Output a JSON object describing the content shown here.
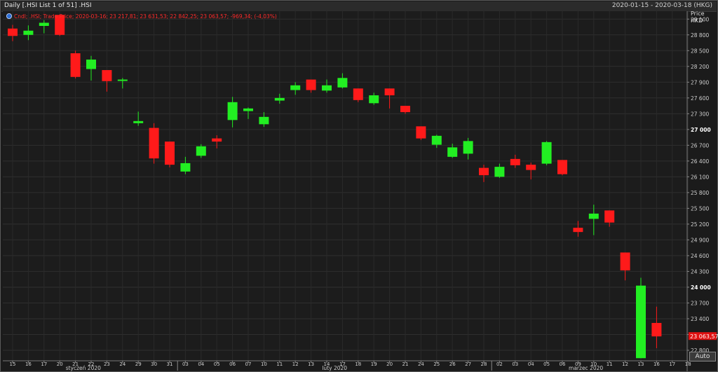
{
  "window": {
    "title": "Daily [.HSI List 1 of 51] .HSI",
    "date_range": "2020-01-15 - 2020-03-18 (HKG)"
  },
  "legend": {
    "text": "Cndl; .HSI; Trade Price; 2020-03-16; 23 217,81; 23 631,53; 22 842,25; 23 063,57; -969,34; (-4,03%)"
  },
  "axis": {
    "price_label": "Price",
    "currency_label": "HKD",
    "auto_label": "Auto",
    "last_price_label": "23 063,57"
  },
  "colors": {
    "up": "#22ee22",
    "down": "#ff1a1a",
    "background": "#1b1b1b",
    "grid": "#2e2e2e"
  },
  "chart_data": {
    "type": "candlestick",
    "ylim": [
      22600,
      29250
    ],
    "yticks": [
      22800,
      23100,
      23400,
      23700,
      24000,
      24300,
      24600,
      24900,
      25200,
      25500,
      25800,
      26100,
      26400,
      26700,
      27000,
      27300,
      27600,
      27900,
      28200,
      28500,
      28800,
      29100
    ],
    "ytick_labels": [
      "22 800",
      "23 100",
      "23 400",
      "23 700",
      "24 000",
      "24 300",
      "24 600",
      "24 900",
      "25 200",
      "25 500",
      "25 800",
      "26 100",
      "26 400",
      "26 700",
      "27 000",
      "27 300",
      "27 600",
      "27 900",
      "28 200",
      "28 500",
      "28 800",
      "29 100"
    ],
    "bold_ytick_labels": [
      "24 000",
      "27 000"
    ],
    "x_labels": [
      "15",
      "16",
      "17",
      "20",
      "21",
      "22",
      "23",
      "24",
      "29",
      "30",
      "31",
      "03",
      "04",
      "05",
      "06",
      "07",
      "10",
      "11",
      "12",
      "13",
      "14",
      "17",
      "18",
      "19",
      "20",
      "21",
      "24",
      "25",
      "26",
      "27",
      "28",
      "02",
      "03",
      "04",
      "05",
      "06",
      "09",
      "10",
      "11",
      "12",
      "13",
      "16",
      "17",
      "18"
    ],
    "month_labels": [
      {
        "label": "styczeń 2020",
        "at_index": 4.5
      },
      {
        "label": "luty 2020",
        "at_index": 20.5
      },
      {
        "label": "marzec 2020",
        "at_index": 36.5
      }
    ],
    "month_separators_before_index": [
      11,
      31
    ],
    "candles": [
      {
        "x": "2020-01-15",
        "o": 28920,
        "h": 28990,
        "l": 28680,
        "c": 28780
      },
      {
        "x": "2020-01-16",
        "o": 28800,
        "h": 28980,
        "l": 28700,
        "c": 28880
      },
      {
        "x": "2020-01-17",
        "o": 28970,
        "h": 29080,
        "l": 28830,
        "c": 29030
      },
      {
        "x": "2020-01-20",
        "o": 29180,
        "h": 29180,
        "l": 28780,
        "c": 28800
      },
      {
        "x": "2020-01-21",
        "o": 28450,
        "h": 28500,
        "l": 27970,
        "c": 28000
      },
      {
        "x": "2020-01-22",
        "o": 28150,
        "h": 28400,
        "l": 27930,
        "c": 28330
      },
      {
        "x": "2020-01-23",
        "o": 28130,
        "h": 28130,
        "l": 27720,
        "c": 27920
      },
      {
        "x": "2020-01-24",
        "o": 27930,
        "h": 27980,
        "l": 27780,
        "c": 27950
      },
      {
        "x": "2020-01-29",
        "o": 27120,
        "h": 27340,
        "l": 27070,
        "c": 27160
      },
      {
        "x": "2020-01-30",
        "o": 27030,
        "h": 27120,
        "l": 26350,
        "c": 26450
      },
      {
        "x": "2020-01-31",
        "o": 26770,
        "h": 26770,
        "l": 26280,
        "c": 26330
      },
      {
        "x": "2020-02-03",
        "o": 26200,
        "h": 26480,
        "l": 26150,
        "c": 26360
      },
      {
        "x": "2020-02-04",
        "o": 26500,
        "h": 26720,
        "l": 26460,
        "c": 26680
      },
      {
        "x": "2020-02-05",
        "o": 26830,
        "h": 26890,
        "l": 26640,
        "c": 26770
      },
      {
        "x": "2020-02-06",
        "o": 27180,
        "h": 27620,
        "l": 27040,
        "c": 27520
      },
      {
        "x": "2020-02-07",
        "o": 27350,
        "h": 27420,
        "l": 27200,
        "c": 27400
      },
      {
        "x": "2020-02-10",
        "o": 27100,
        "h": 27330,
        "l": 27050,
        "c": 27240
      },
      {
        "x": "2020-02-11",
        "o": 27550,
        "h": 27680,
        "l": 27490,
        "c": 27600
      },
      {
        "x": "2020-02-12",
        "o": 27750,
        "h": 27900,
        "l": 27660,
        "c": 27840
      },
      {
        "x": "2020-02-13",
        "o": 27950,
        "h": 27950,
        "l": 27700,
        "c": 27750
      },
      {
        "x": "2020-02-14",
        "o": 27740,
        "h": 27950,
        "l": 27700,
        "c": 27840
      },
      {
        "x": "2020-02-17",
        "o": 27800,
        "h": 28070,
        "l": 27780,
        "c": 27980
      },
      {
        "x": "2020-02-18",
        "o": 27780,
        "h": 27780,
        "l": 27520,
        "c": 27560
      },
      {
        "x": "2020-02-19",
        "o": 27500,
        "h": 27700,
        "l": 27470,
        "c": 27650
      },
      {
        "x": "2020-02-20",
        "o": 27780,
        "h": 27780,
        "l": 27400,
        "c": 27650
      },
      {
        "x": "2020-02-21",
        "o": 27450,
        "h": 27450,
        "l": 27300,
        "c": 27330
      },
      {
        "x": "2020-02-24",
        "o": 27060,
        "h": 27060,
        "l": 26800,
        "c": 26830
      },
      {
        "x": "2020-02-25",
        "o": 26710,
        "h": 26900,
        "l": 26650,
        "c": 26880
      },
      {
        "x": "2020-02-26",
        "o": 26480,
        "h": 26730,
        "l": 26460,
        "c": 26660
      },
      {
        "x": "2020-02-27",
        "o": 26540,
        "h": 26840,
        "l": 26430,
        "c": 26780
      },
      {
        "x": "2020-02-28",
        "o": 26270,
        "h": 26330,
        "l": 26000,
        "c": 26130
      },
      {
        "x": "2020-03-02",
        "o": 26100,
        "h": 26350,
        "l": 26080,
        "c": 26290
      },
      {
        "x": "2020-03-03",
        "o": 26440,
        "h": 26520,
        "l": 26270,
        "c": 26320
      },
      {
        "x": "2020-03-04",
        "o": 26330,
        "h": 26370,
        "l": 26050,
        "c": 26230
      },
      {
        "x": "2020-03-05",
        "o": 26350,
        "h": 26780,
        "l": 26320,
        "c": 26760
      },
      {
        "x": "2020-03-06",
        "o": 26420,
        "h": 26420,
        "l": 26130,
        "c": 26150
      },
      {
        "x": "2020-03-09",
        "o": 25130,
        "h": 25260,
        "l": 24960,
        "c": 25050
      },
      {
        "x": "2020-03-10",
        "o": 25300,
        "h": 25570,
        "l": 24990,
        "c": 25400
      },
      {
        "x": "2020-03-11",
        "o": 25460,
        "h": 25460,
        "l": 25150,
        "c": 25230
      },
      {
        "x": "2020-03-12",
        "o": 24660,
        "h": 24660,
        "l": 24130,
        "c": 24320
      },
      {
        "x": "2020-03-13",
        "o": 22650,
        "h": 24180,
        "l": 22650,
        "c": 24030
      },
      {
        "x": "2020-03-16",
        "o": 23320,
        "h": 23630,
        "l": 22840,
        "c": 23064
      }
    ]
  }
}
